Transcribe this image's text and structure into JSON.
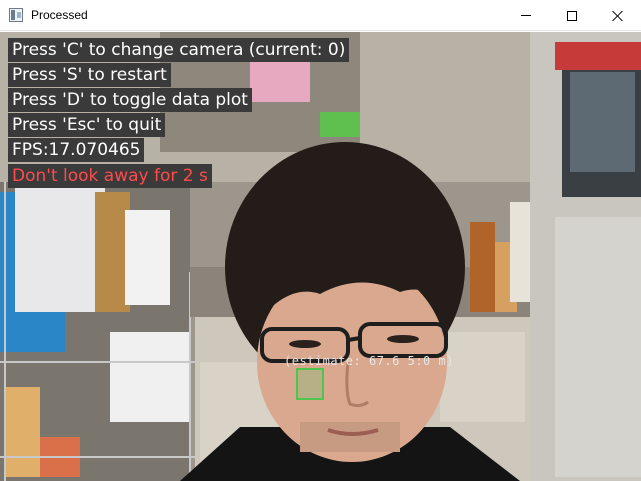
{
  "window": {
    "title": "Processed",
    "icon": "window-app-icon",
    "controls": [
      "minimize-icon",
      "maximize-icon",
      "close-icon"
    ]
  },
  "overlay": {
    "lines": [
      "Press 'C' to change camera (current: 0)",
      "Press 'S' to restart",
      "Press 'D' to toggle data plot",
      "Press 'Esc' to quit",
      "FPS:17.070465",
      "Don't look away for 2 s"
    ],
    "estimate_label": "(estimate: 67.6 5:0 m)",
    "colors": {
      "text": "#ffffff",
      "warning": "#ff4b4b",
      "box_bg": "#3a3a3a",
      "gaze_box": "#4fc44f"
    }
  }
}
